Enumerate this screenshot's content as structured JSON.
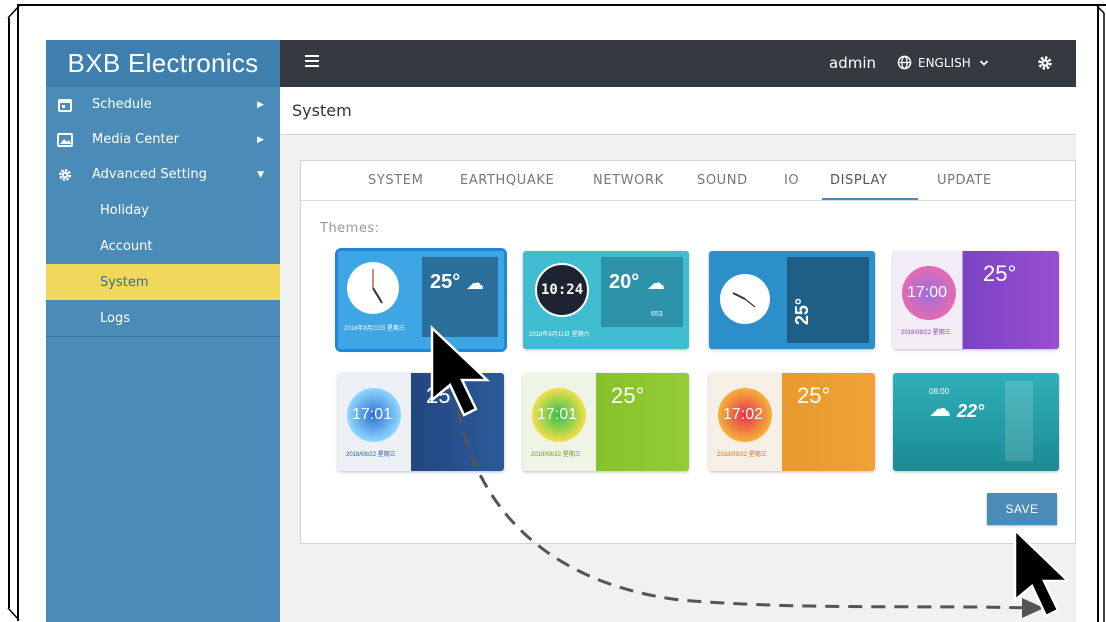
{
  "brand": "BXB Electronics",
  "sidebar": {
    "items": [
      {
        "label": "Schedule",
        "icon": "calendar-icon"
      },
      {
        "label": "Media Center",
        "icon": "image-icon"
      },
      {
        "label": "Advanced Setting",
        "icon": "gear-icon"
      }
    ],
    "sub_items": [
      {
        "label": "Holiday"
      },
      {
        "label": "Account"
      },
      {
        "label": "System"
      },
      {
        "label": "Logs"
      }
    ],
    "active": "System"
  },
  "topbar": {
    "user": "admin",
    "language": "ENGLISH"
  },
  "page": {
    "title": "System",
    "tabs": [
      "SYSTEM",
      "EARTHQUAKE",
      "NETWORK",
      "SOUND",
      "IO",
      "DISPLAY",
      "UPDATE"
    ],
    "active_tab": "DISPLAY",
    "themes_label": "Themes:",
    "save_label": "SAVE"
  },
  "themes": [
    {
      "time": "",
      "temp": "25°",
      "date": "2018年8月22日 星期三"
    },
    {
      "time": "10:24",
      "temp": "20°",
      "date": "2018年8月11日 星期六",
      "extra": "653"
    },
    {
      "time": "",
      "temp": "25°",
      "date": ""
    },
    {
      "time": "17:00",
      "temp": "25°",
      "date": "2018/08/22 星期三"
    },
    {
      "time": "17:01",
      "temp": "25°",
      "date": "2018/08/22 星期三"
    },
    {
      "time": "17:01",
      "temp": "25°",
      "date": "2018/08/22 星期三"
    },
    {
      "time": "17:02",
      "temp": "25°",
      "date": "2018/08/22 星期三"
    },
    {
      "time": "08:00",
      "temp": "22°",
      "date": ""
    }
  ],
  "colors": {
    "sidebar": "#4a8bb8",
    "topbar": "#343a40",
    "active_item": "#f1d75b",
    "accent": "#1e87d8"
  }
}
